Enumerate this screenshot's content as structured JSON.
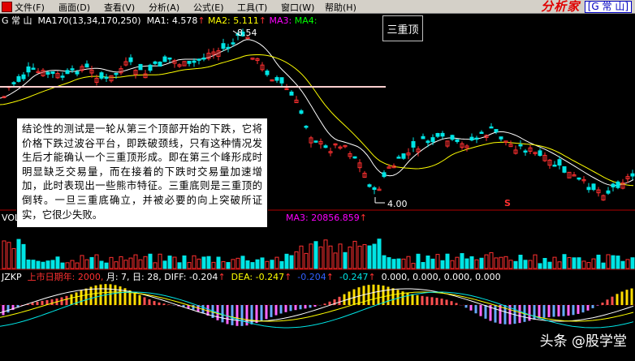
{
  "menu": {
    "items": [
      "文件(F)",
      "画面(D)",
      "查看(V)",
      "分析(A)",
      "公式(E)",
      "工具(T)",
      "窗口(W)",
      "帮助(H)"
    ]
  },
  "brand": {
    "name": "分析家",
    "stock": "[G 常 山]"
  },
  "price_panel": {
    "stock_name": "G 常 山",
    "ma170": "MA170(13,34,170,250)",
    "ma1": "MA1: 4.578",
    "ma2": "MA2: 5.111",
    "ma3": "MA3:",
    "ma4": "MA4:",
    "high_label": "8.54",
    "low_label": "4.00"
  },
  "pattern_label": "三重顶",
  "annotation": "结论性的测试是一轮从第三个顶部开始的下跌，它将价格下跌过波谷平台，即跌破颈线，只有这种情况发生后才能确认一个三重顶形成。即在第三个峰形成时明显缺乏交易量，而在接着的下跌时交易量加速增加，此时表现出一些熊市特征。三重底则是三重顶的倒转。一旦三重底确立，并被必要的向上突破所证实，它很少失败。",
  "volume_panel": {
    "label": "VOL",
    "ma3": "MA3: 20856.859"
  },
  "jzkp_panel": {
    "name": "JZKP",
    "listing": "上市日期年: 2000,",
    "month": "月: 7,",
    "day": "日: 28,",
    "diff": "DIFF: -0.204",
    "dea": "DEA: -0.247",
    "v1": "-0.204",
    "v2": "-0.247",
    "v3": "0.000, 0.000, 0.000, 0.000"
  },
  "marker": "S",
  "watermark": "头条 @股学堂",
  "colors": {
    "up": "#ff3030",
    "down": "#00e5e5",
    "neckline": "#ffd0d0",
    "ma_white": "#ffffff",
    "ma_yellow": "#ffff00"
  }
}
